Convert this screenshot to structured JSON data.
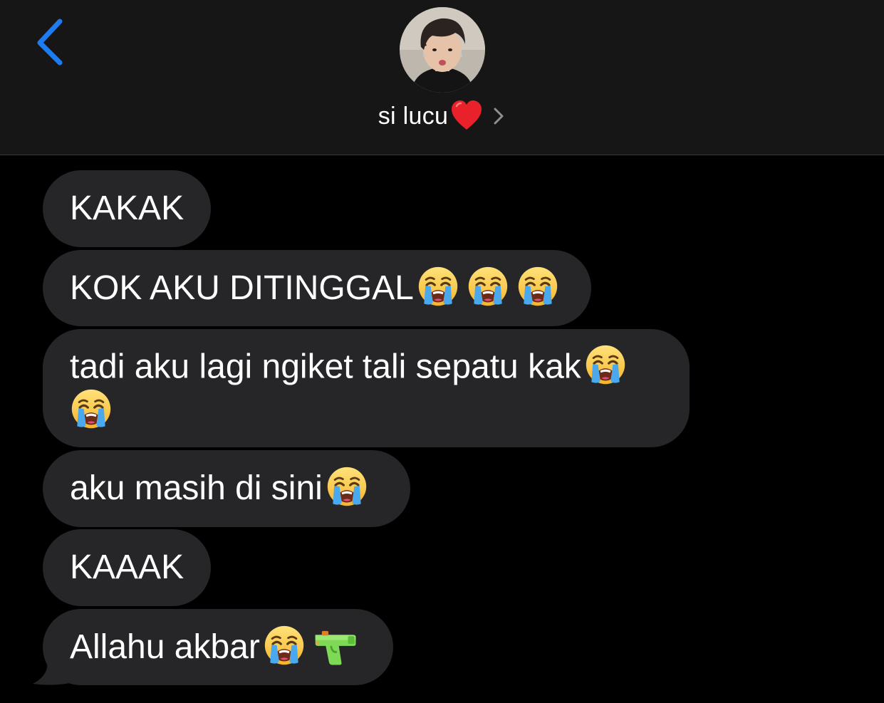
{
  "header": {
    "contact_name": "si lucu",
    "name_emoji": "red-heart",
    "back_icon": "chevron-left-icon",
    "disclosure_icon": "chevron-right-icon",
    "accent_color": "#1f7cf0"
  },
  "messages": [
    {
      "text": "KAKAK",
      "emoji": []
    },
    {
      "text": "KOK AKU DITINGGAL",
      "emoji": [
        "loudly-crying-face",
        "loudly-crying-face",
        "loudly-crying-face"
      ]
    },
    {
      "text": "tadi aku lagi ngiket tali sepatu kak",
      "emoji": [
        "loudly-crying-face",
        "loudly-crying-face"
      ]
    },
    {
      "text": "aku masih di sini",
      "emoji": [
        "loudly-crying-face"
      ]
    },
    {
      "text": "KAAAK",
      "emoji": []
    },
    {
      "text": "Allahu akbar",
      "emoji": [
        "loudly-crying-face",
        "water-pistol"
      ]
    }
  ],
  "colors": {
    "header_bg": "#161616",
    "bubble_bg": "#262628",
    "background": "#000000"
  }
}
